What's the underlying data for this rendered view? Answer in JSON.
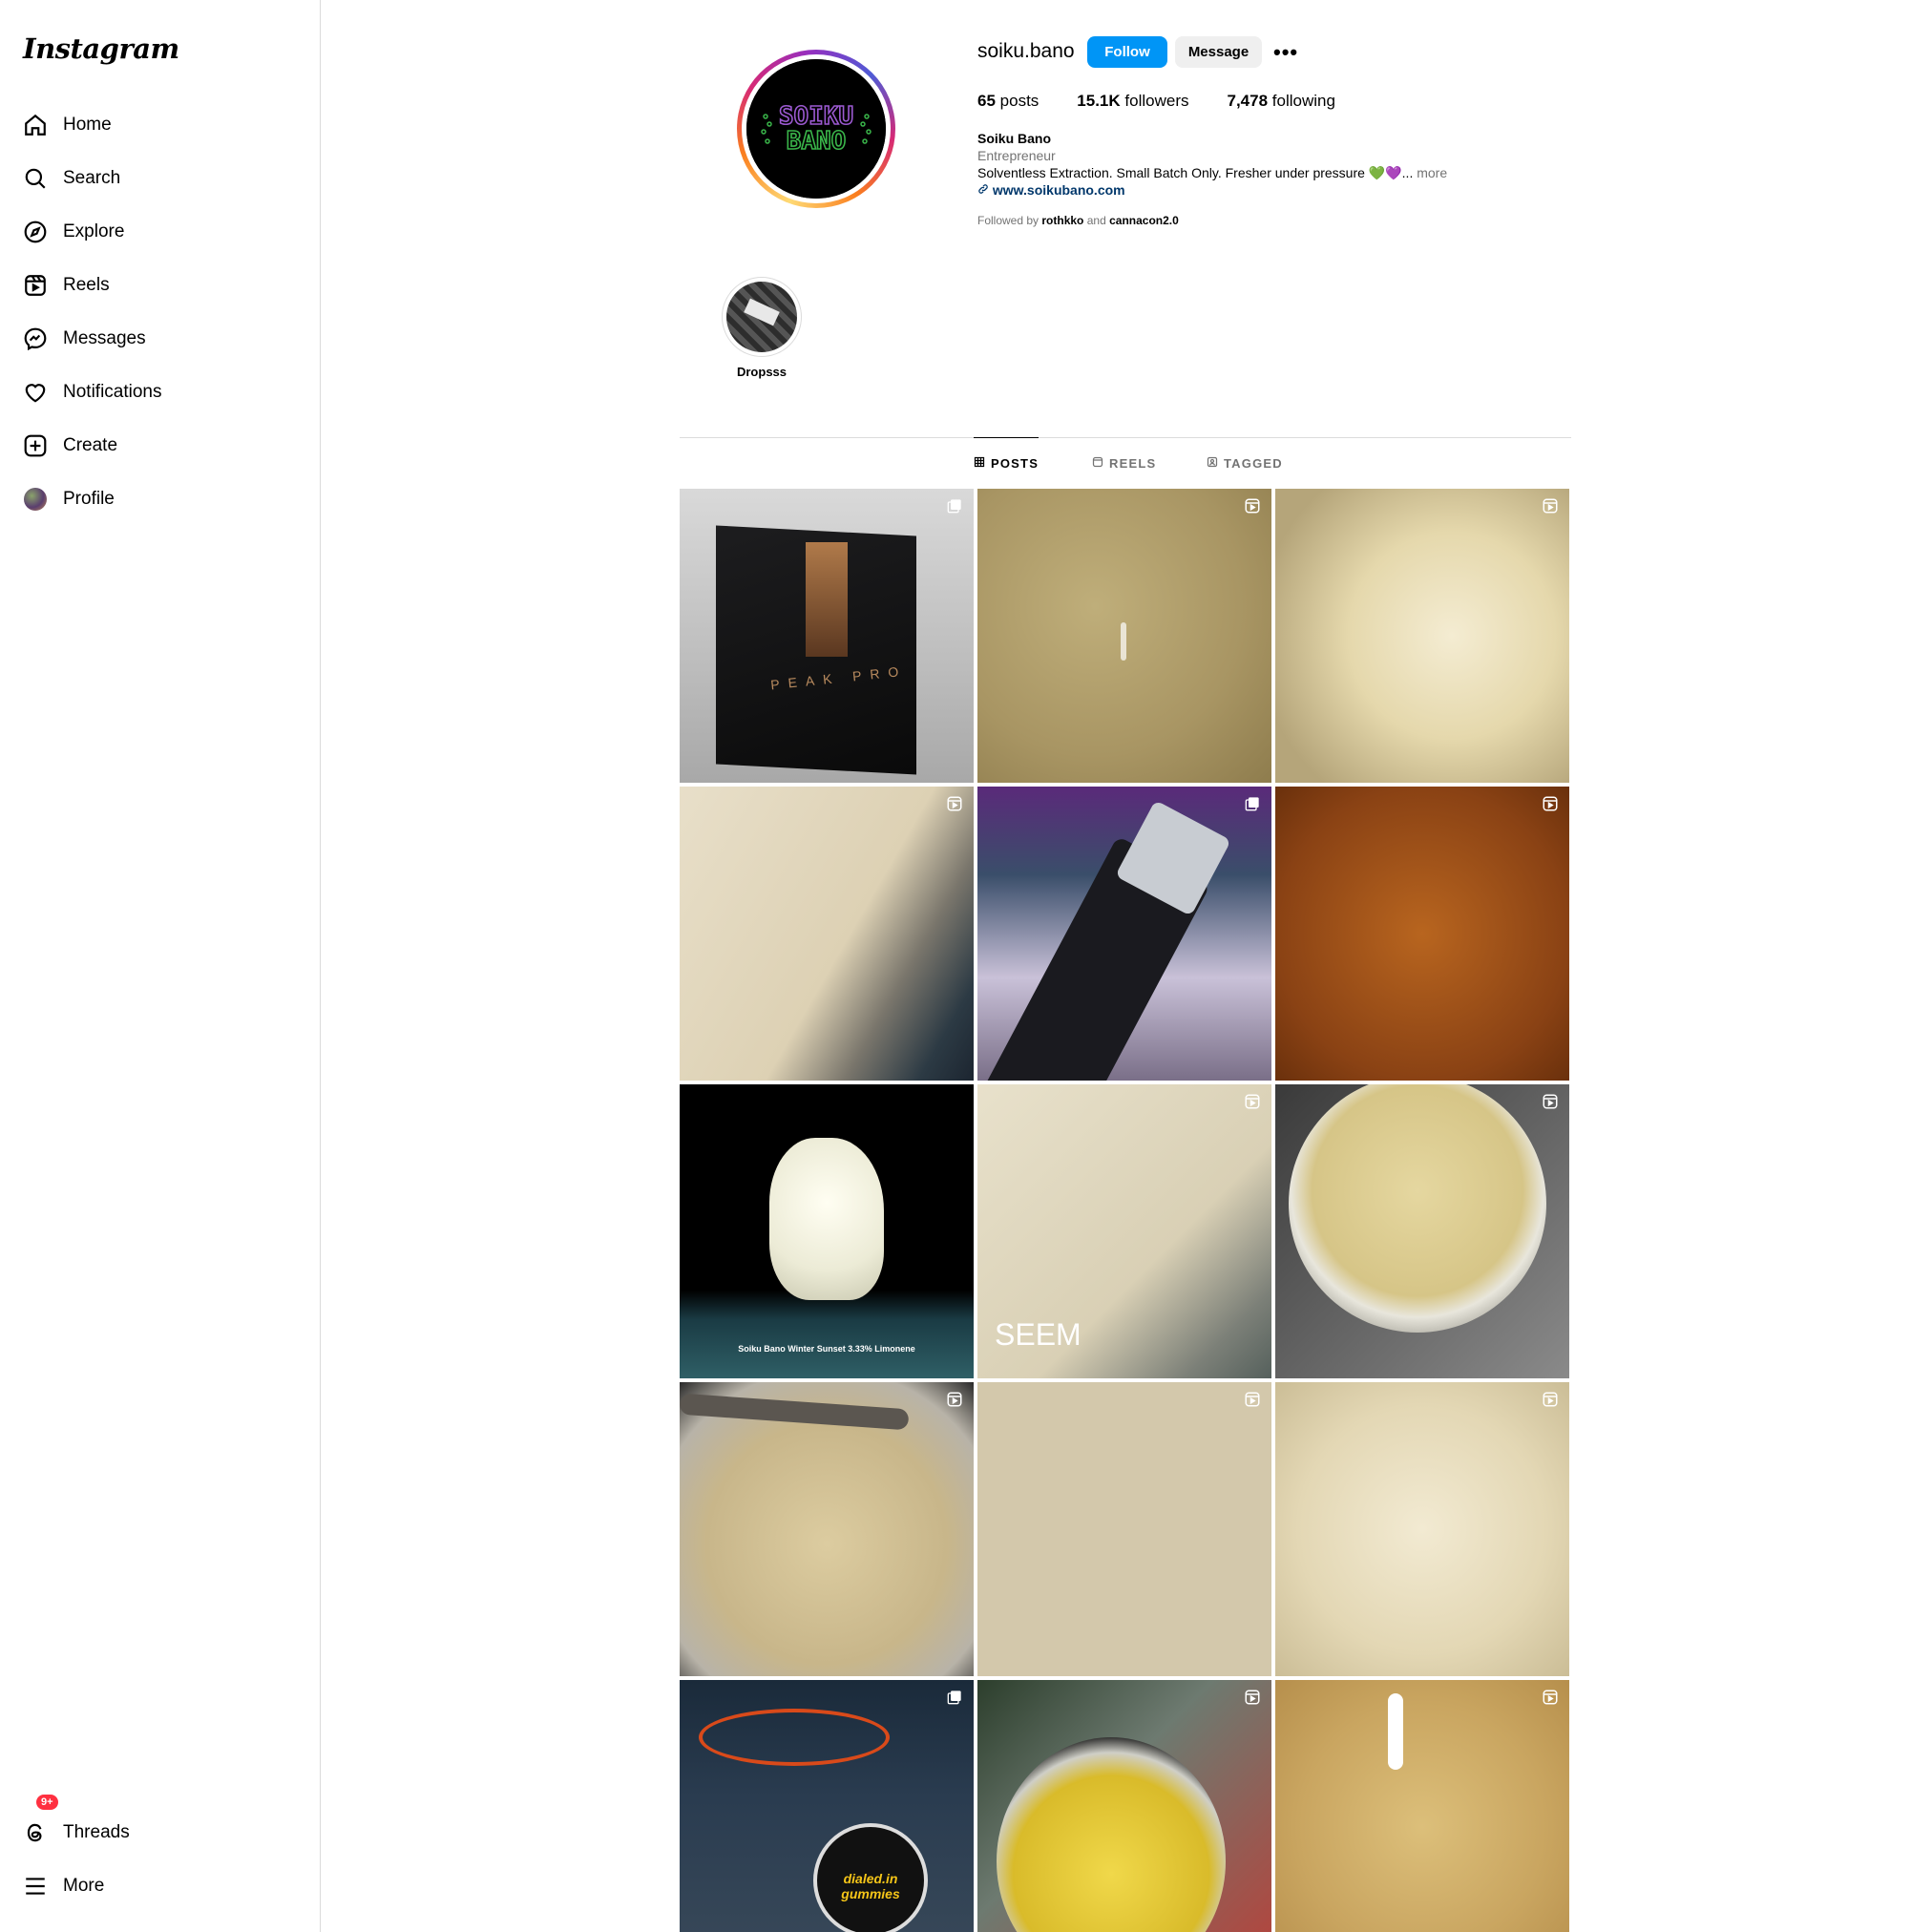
{
  "sidebar": {
    "logo": "Instagram",
    "items": [
      {
        "label": "Home",
        "icon": "home-icon"
      },
      {
        "label": "Search",
        "icon": "search-icon"
      },
      {
        "label": "Explore",
        "icon": "compass-icon"
      },
      {
        "label": "Reels",
        "icon": "reels-icon"
      },
      {
        "label": "Messages",
        "icon": "messenger-icon"
      },
      {
        "label": "Notifications",
        "icon": "heart-icon"
      },
      {
        "label": "Create",
        "icon": "plus-square-icon"
      },
      {
        "label": "Profile",
        "icon": "avatar"
      }
    ],
    "bottom": [
      {
        "label": "Threads",
        "icon": "threads-icon",
        "badge": "9+"
      },
      {
        "label": "More",
        "icon": "hamburger-icon"
      }
    ]
  },
  "profile": {
    "username": "soiku.bano",
    "follow_label": "Follow",
    "message_label": "Message",
    "more": "•••",
    "stats": {
      "posts_count": "65",
      "posts_label": "posts",
      "followers_count": "15.1K",
      "followers_label": "followers",
      "following_count": "7,478",
      "following_label": "following"
    },
    "bio": {
      "name": "Soiku Bano",
      "category": "Entrepreneur",
      "text": "Solventless Extraction. Small Batch Only. Fresher under pressure 💚💜...",
      "more": "more",
      "link": "www.soikubano.com"
    },
    "followed_by": {
      "prefix": "Followed by",
      "user1": "rothkko",
      "and": "and",
      "user2": "cannacon2.0"
    },
    "avatar_text": [
      "SOIKU",
      "BANO"
    ]
  },
  "highlights": [
    {
      "label": "Dropsss"
    }
  ],
  "tabs": [
    {
      "label": "POSTS",
      "active": true
    },
    {
      "label": "REELS",
      "active": false
    },
    {
      "label": "TAGGED",
      "active": false
    }
  ],
  "posts": [
    {
      "type": "carousel",
      "overlay": "PEAK PRO"
    },
    {
      "type": "reel"
    },
    {
      "type": "reel"
    },
    {
      "type": "reel"
    },
    {
      "type": "carousel"
    },
    {
      "type": "reel"
    },
    {
      "type": "image",
      "overlay": "Soiku Bano Winter Sunset 3.33% Limonene"
    },
    {
      "type": "reel",
      "overlay": "SEEM"
    },
    {
      "type": "reel"
    },
    {
      "type": "reel"
    },
    {
      "type": "reel"
    },
    {
      "type": "reel"
    },
    {
      "type": "carousel",
      "overlay": "dialed.in gummies"
    },
    {
      "type": "reel"
    },
    {
      "type": "reel"
    }
  ],
  "colors": {
    "accent": "#0095f6",
    "badge": "#ff3040",
    "link": "#00376b",
    "border": "#dbdbdb",
    "muted": "#737373"
  }
}
